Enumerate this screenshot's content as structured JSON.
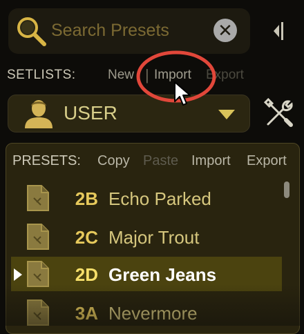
{
  "search": {
    "placeholder": "Search Presets"
  },
  "setlists": {
    "label": "SETLISTS:",
    "new": "New",
    "import": "Import",
    "export": "Export"
  },
  "user_dropdown": {
    "label": "USER"
  },
  "presets_toolbar": {
    "label": "PRESETS:",
    "copy": "Copy",
    "paste": "Paste",
    "import": "Import",
    "export": "Export"
  },
  "presets": [
    {
      "code": "2B",
      "name": "Echo Parked",
      "selected": false
    },
    {
      "code": "2C",
      "name": "Major Trout",
      "selected": false
    },
    {
      "code": "2D",
      "name": "Green Jeans",
      "selected": true
    },
    {
      "code": "3A",
      "name": "Nevermore",
      "selected": false
    }
  ],
  "colors": {
    "accent_gold": "#e6c95c",
    "panel_bg": "#29240f",
    "selected_row": "#4b430f",
    "annotation_red": "#e1473a"
  },
  "icons": [
    "search-icon",
    "clear-icon",
    "collapse-panel-icon",
    "user-avatar-icon",
    "chevron-down-icon",
    "tools-icon",
    "preset-file-icon",
    "play-marker-icon",
    "mouse-cursor-icon"
  ]
}
